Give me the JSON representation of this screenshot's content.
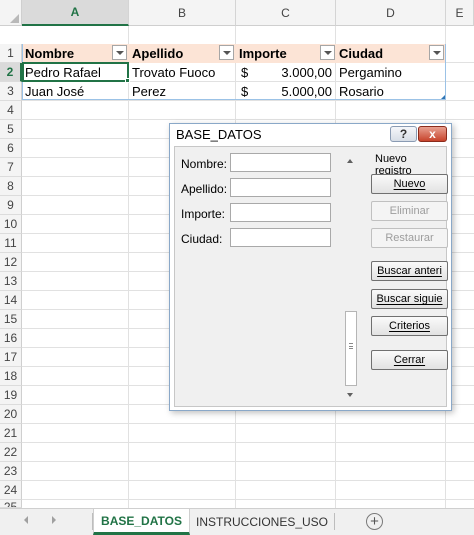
{
  "sheet": {
    "column_headers": [
      "A",
      "B",
      "C",
      "D",
      "E"
    ],
    "row_numbers": [
      "1",
      "2",
      "3",
      "4",
      "5",
      "6",
      "7",
      "8",
      "9",
      "10",
      "11",
      "12",
      "13",
      "14",
      "15",
      "16",
      "17",
      "18",
      "19",
      "20",
      "21",
      "22",
      "23",
      "24",
      "25"
    ],
    "active_cell": "A2",
    "table": {
      "headers": [
        "Nombre",
        "Apellido",
        "Importe",
        "Ciudad"
      ],
      "rows": [
        {
          "nombre": "Pedro Rafael",
          "apellido": "Trovato Fuoco",
          "currency": "$",
          "importe": "3.000,00",
          "ciudad": "Pergamino"
        },
        {
          "nombre": "Juan José",
          "apellido": "Perez",
          "currency": "$",
          "importe": "5.000,00",
          "ciudad": "Rosario"
        }
      ],
      "header_fill": "#fce4d6",
      "border_color": "#9bc2e6"
    }
  },
  "dialog": {
    "title": "BASE_DATOS",
    "help_label": "?",
    "close_label": "x",
    "record_label": "Nuevo registro",
    "fields": [
      {
        "label": "Nombre:",
        "value": ""
      },
      {
        "label": "Apellido:",
        "value": ""
      },
      {
        "label": "Importe:",
        "value": ""
      },
      {
        "label": "Ciudad:",
        "value": ""
      }
    ],
    "buttons": {
      "nuevo": "Nuevo",
      "eliminar": "Eliminar",
      "restaurar": "Restaurar",
      "buscar_anterior": "Buscar anteri",
      "buscar_siguiente": "Buscar siguie",
      "criterios": "Criterios",
      "cerrar": "Cerrar"
    },
    "disabled_buttons": [
      "Eliminar",
      "Restaurar"
    ]
  },
  "tabs": {
    "items": [
      "BASE_DATOS",
      "INSTRUCCIONES_USO"
    ],
    "active": "BASE_DATOS",
    "add_label": "+"
  },
  "colors": {
    "accent": "#217346",
    "close_red": "#c7432b"
  },
  "icons": {
    "help": "question-mark-icon",
    "close": "close-icon",
    "filter": "filter-dropdown-icon",
    "add_sheet": "plus-circle-icon"
  }
}
